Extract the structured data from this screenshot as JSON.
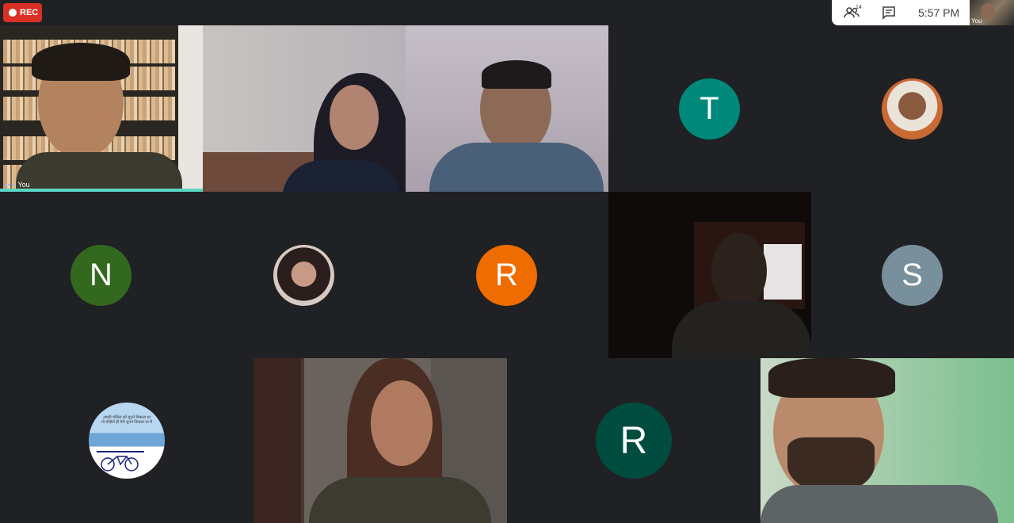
{
  "recording": {
    "label": "REC",
    "color": "#d93025"
  },
  "toolbar": {
    "participants_icon": "people-icon",
    "participant_count": "14",
    "chat_icon": "chat-icon",
    "time": "5:57  PM"
  },
  "self_view": {
    "label": "You"
  },
  "grid": {
    "self_tile_label": "You",
    "avatars": [
      {
        "id": "t",
        "letter": "T",
        "color": "#00897b"
      },
      {
        "id": "n",
        "letter": "N",
        "color": "#33691e"
      },
      {
        "id": "r1",
        "letter": "R",
        "color": "#ef6c00"
      },
      {
        "id": "s",
        "letter": "S",
        "color": "#78909c"
      },
      {
        "id": "r2",
        "letter": "R",
        "color": "#004d40"
      }
    ],
    "quote_avatar_text": [
      "अपनी मंज़िल को चुनने निकला था",
      "तो मंज़िलें ही मेरी चुनने निकला था मैं"
    ]
  }
}
